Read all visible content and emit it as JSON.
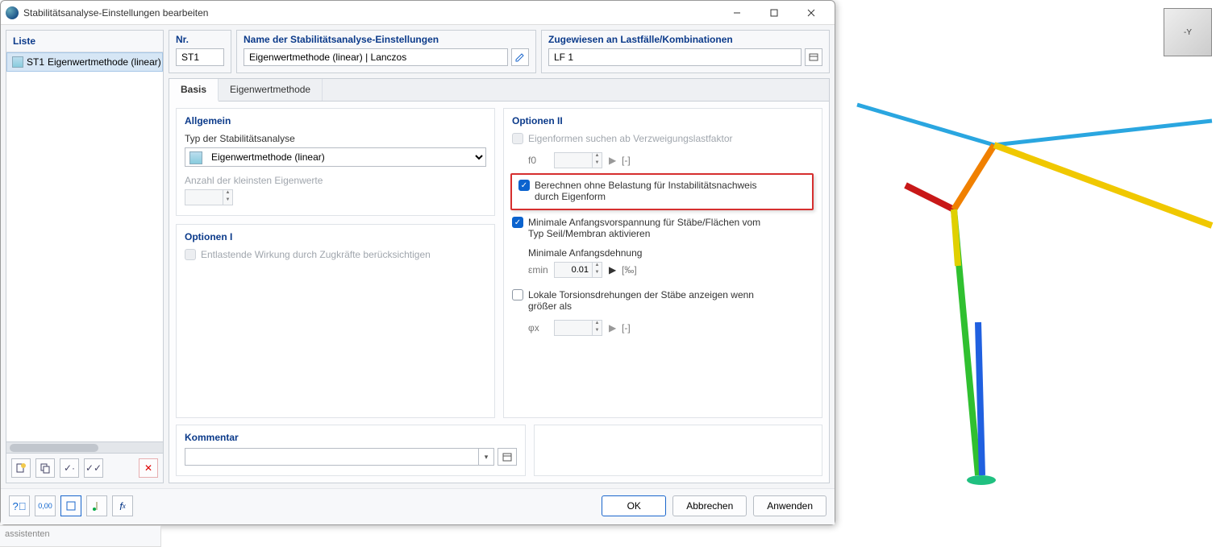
{
  "window": {
    "title": "Stabilitätsanalyse-Einstellungen bearbeiten"
  },
  "list": {
    "header": "Liste",
    "rows": [
      {
        "id": "ST1",
        "name": "Eigenwertmethode (linear) | Lancz"
      }
    ]
  },
  "nr": {
    "label": "Nr.",
    "value": "ST1"
  },
  "name_settings": {
    "label": "Name der Stabilitätsanalyse-Einstellungen",
    "value": "Eigenwertmethode (linear) | Lanczos"
  },
  "assigned": {
    "label": "Zugewiesen an Lastfälle/Kombinationen",
    "value": "LF 1"
  },
  "tabs": {
    "basis": "Basis",
    "eigen": "Eigenwertmethode"
  },
  "allgemein": {
    "title": "Allgemein",
    "type_label": "Typ der Stabilitätsanalyse",
    "type_value": "Eigenwertmethode (linear)",
    "count_label": "Anzahl der kleinsten Eigenwerte",
    "count_value": ""
  },
  "options1": {
    "title": "Optionen I",
    "relief_label": "Entlastende Wirkung durch Zugkräfte berücksichtigen",
    "relief_checked": false,
    "relief_disabled": true
  },
  "options2": {
    "title": "Optionen II",
    "eigenforms_label": "Eigenformen suchen ab Verzweigungslastfaktor",
    "eigenforms_checked": false,
    "eigenforms_disabled": true,
    "f0_label": "f0",
    "f0_value": "",
    "f0_unit": "[-]",
    "calc_noload_label": "Berechnen ohne Belastung für Instabilitätsnachweis durch Eigenform",
    "calc_noload_checked": true,
    "min_prestress_label": "Minimale Anfangsvorspannung für Stäbe/Flächen vom Typ Seil/Membran aktivieren",
    "min_prestress_checked": true,
    "min_strain_label": "Minimale Anfangsdehnung",
    "emin_label": "εmin",
    "emin_value": "0.01",
    "emin_unit": "[‰]",
    "torsion_label": "Lokale Torsionsdrehungen der Stäbe anzeigen wenn größer als",
    "torsion_checked": false,
    "phix_label": "φx",
    "phix_value": "",
    "phix_unit": "[-]"
  },
  "kommentar": {
    "title": "Kommentar",
    "value": ""
  },
  "buttons": {
    "ok": "OK",
    "cancel": "Abbrechen",
    "apply": "Anwenden"
  },
  "stub": {
    "assist": "assistenten"
  },
  "axis_cube": "-Y"
}
